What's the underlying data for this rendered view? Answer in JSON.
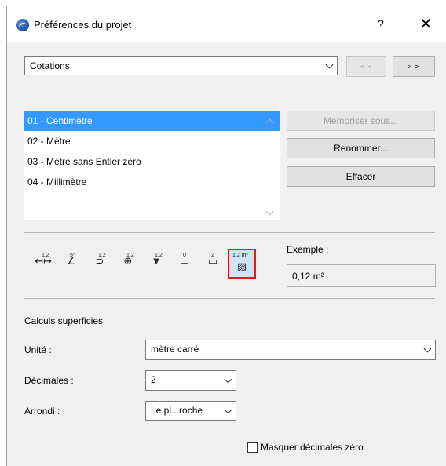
{
  "window": {
    "title": "Préférences du projet",
    "help_label": "?",
    "close_label": "✕"
  },
  "header": {
    "category_value": "Cotations",
    "prev_label": "< <",
    "next_label": "> >"
  },
  "presets": {
    "items": [
      {
        "label": "01 - Centimètre",
        "selected": true
      },
      {
        "label": "02 - Mètre",
        "selected": false
      },
      {
        "label": "03 - Mètre sans Entier zéro",
        "selected": false
      },
      {
        "label": "04 - Millimètre",
        "selected": false
      }
    ],
    "save_as_label": "Mémoriser sous...",
    "rename_label": "Renommer...",
    "delete_label": "Effacer"
  },
  "dimension_types": {
    "icons": [
      {
        "name": "linear-dimension-icon",
        "glyph": "↤↦",
        "sup": "1.2"
      },
      {
        "name": "angle-dimension-icon",
        "glyph": "∠",
        "sup": "5°"
      },
      {
        "name": "radial-dimension-icon",
        "glyph": "⊃",
        "sup": "1.2"
      },
      {
        "name": "level-dimension-icon",
        "glyph": "⊕",
        "sup": "1.2"
      },
      {
        "name": "elevation-dimension-icon",
        "glyph": "▼",
        "sup": "1.2"
      },
      {
        "name": "door-window-dimension-icon",
        "glyph": "▭",
        "sup": "0"
      },
      {
        "name": "sill-height-dimension-icon",
        "glyph": "▭",
        "sup": "2"
      },
      {
        "name": "area-calculation-icon",
        "glyph": "▨",
        "sup": "1.2 m²",
        "active": true
      }
    ],
    "example_label": "Exemple :",
    "example_value": "0,12 m²"
  },
  "area_calc": {
    "section_title": "Calculs superficies",
    "unit_label": "Unité :",
    "unit_value": "mètre carré",
    "decimals_label": "Décimales :",
    "decimals_value": "2",
    "rounding_label": "Arrondi :",
    "rounding_value": "Le pl...roche",
    "hide_zero_label": "Masquer décimales zéro"
  }
}
